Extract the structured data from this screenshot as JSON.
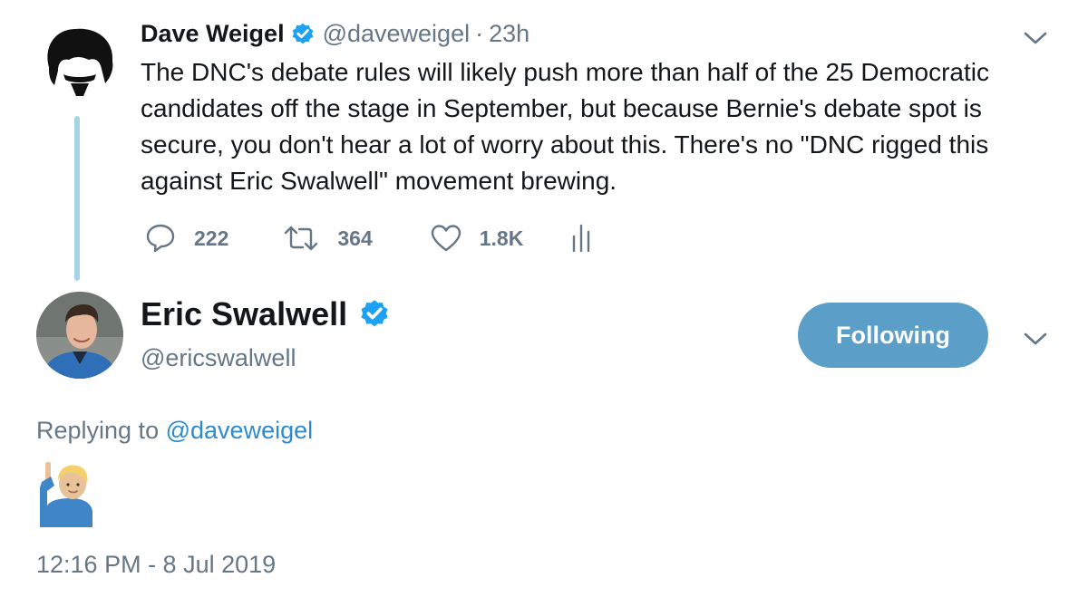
{
  "parent_tweet": {
    "author_name": "Dave Weigel",
    "author_handle": "@daveweigel",
    "separator": "·",
    "time_ago": "23h",
    "text": "The DNC's debate rules will likely push more than half of the 25 Democratic candidates off the stage in September, but because Bernie's debate spot is secure, you don't hear a lot of worry about this. There's no \"DNC rigged this against Eric Swalwell\" movement brewing.",
    "reply_count": "222",
    "retweet_count": "364",
    "like_count": "1.8K"
  },
  "reply_tweet": {
    "author_name": "Eric Swalwell",
    "author_handle": "@ericswalwell",
    "follow_label": "Following",
    "replying_prefix": "Replying to",
    "replying_handle": "@daveweigel",
    "emoji": "man-raising-hand-emoji",
    "timestamp": "12:16 PM - 8 Jul 2019"
  },
  "icons": {
    "verified": "verified-badge-icon",
    "caret": "chevron-down-icon",
    "reply": "reply-icon",
    "retweet": "retweet-icon",
    "like": "heart-icon",
    "analytics": "analytics-icon"
  },
  "colors": {
    "verified_blue": "#1da1f2",
    "follow_button": "#5b9fc8",
    "link_blue": "#2b8bd1",
    "muted_gray": "#657786",
    "thread_line": "#a7d3e6"
  }
}
